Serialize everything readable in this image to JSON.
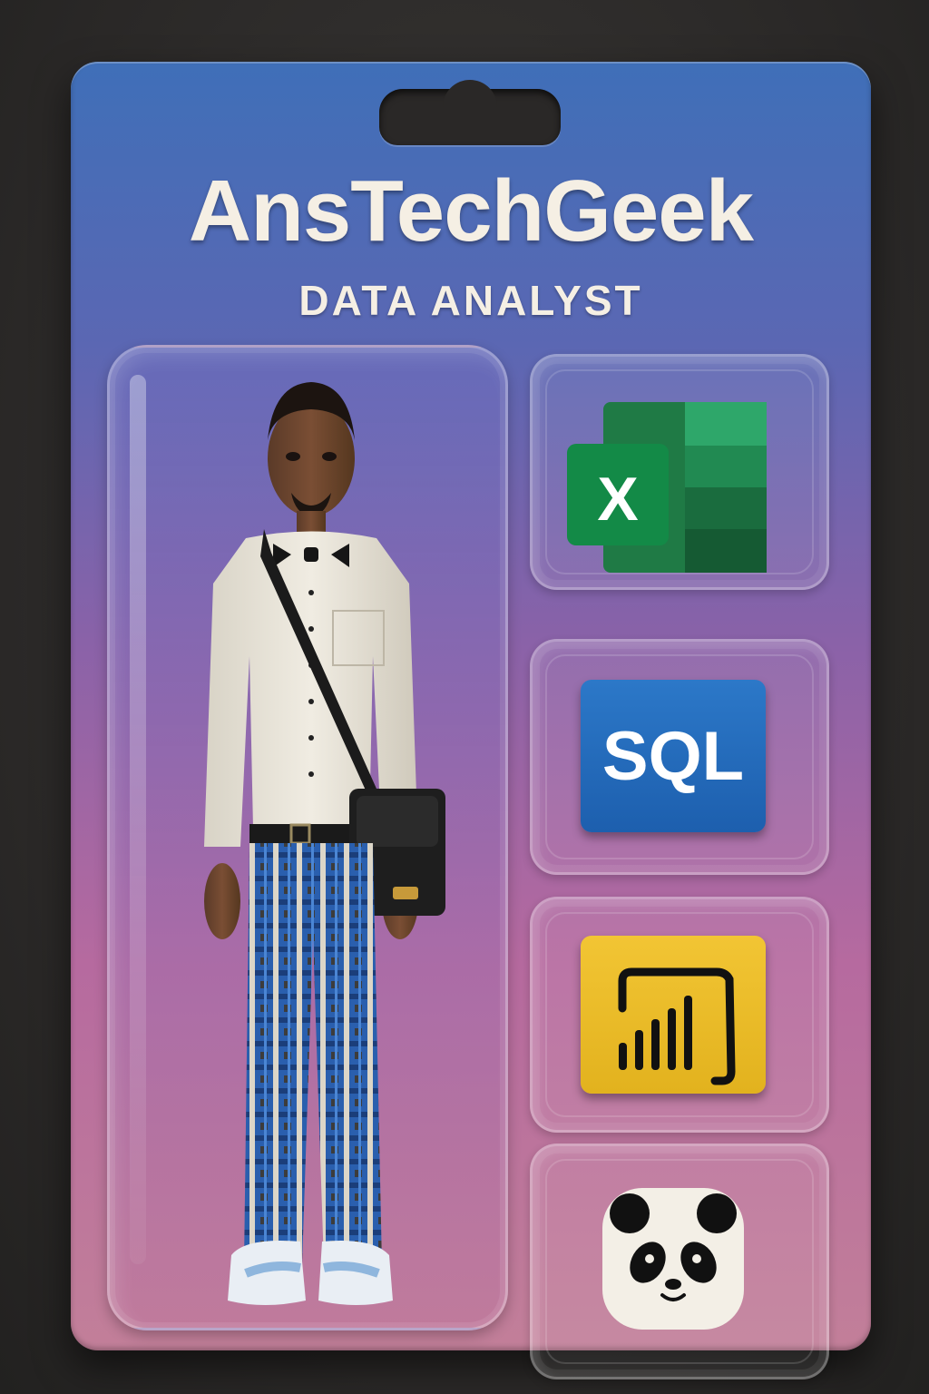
{
  "card": {
    "title": "AnsTechGeek",
    "subtitle": "DATA ANALYST"
  },
  "tools": [
    {
      "name": "excel-icon",
      "label": "X"
    },
    {
      "name": "sql-icon",
      "label": "SQL"
    },
    {
      "name": "powerbi-icon"
    },
    {
      "name": "pandas-icon"
    }
  ],
  "colors": {
    "card_top": "#3f6fb8",
    "card_bottom": "#c27f99",
    "excel_green": "#1f7a45",
    "sql_blue": "#1d5fae",
    "powerbi_yellow": "#f2c534"
  }
}
